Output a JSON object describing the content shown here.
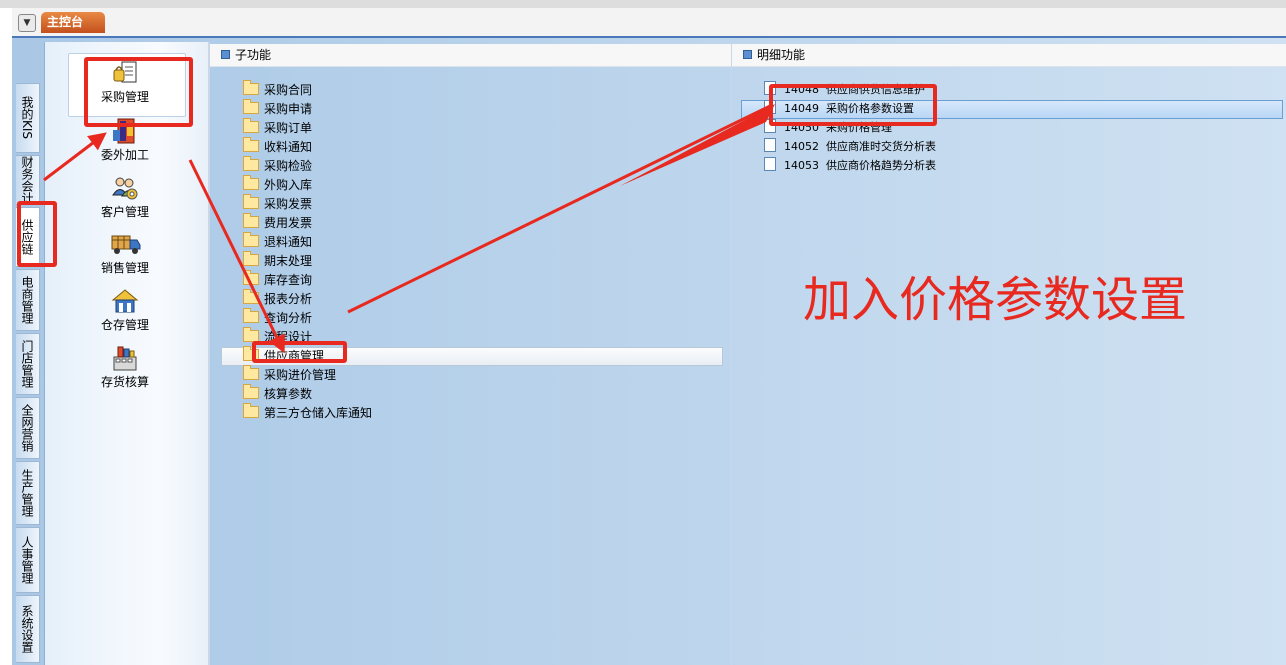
{
  "tabbar": {
    "main_tab": "主控台"
  },
  "vertical_tabs": [
    {
      "label": "我的KIS"
    },
    {
      "label": "财务会计"
    },
    {
      "label": "供应链",
      "active": true
    },
    {
      "label": "电商管理"
    },
    {
      "label": "门店管理"
    },
    {
      "label": "全网营销"
    },
    {
      "label": "生产管理"
    },
    {
      "label": "人事管理"
    },
    {
      "label": "系统设置"
    }
  ],
  "modules": [
    {
      "label": "采购管理",
      "icon": "purchase-icon",
      "selected": true
    },
    {
      "label": "委外加工",
      "icon": "outsourcing-icon"
    },
    {
      "label": "客户管理",
      "icon": "customer-icon"
    },
    {
      "label": "销售管理",
      "icon": "sales-truck-icon"
    },
    {
      "label": "仓存管理",
      "icon": "warehouse-icon"
    },
    {
      "label": "存货核算",
      "icon": "inventory-accounting-icon"
    }
  ],
  "subfunctions": {
    "header": "子功能",
    "items": [
      "采购合同",
      "采购申请",
      "采购订单",
      "收料通知",
      "采购检验",
      "外购入库",
      "采购发票",
      "费用发票",
      "退料通知",
      "期末处理",
      "库存查询",
      "报表分析",
      "查询分析",
      "流程设计",
      "供应商管理",
      "采购进价管理",
      "核算参数",
      "第三方仓储入库通知"
    ],
    "selected": "供应商管理"
  },
  "details": {
    "header": "明细功能",
    "items": [
      {
        "code": "14048",
        "label": "供应商供货信息维护"
      },
      {
        "code": "14049",
        "label": "采购价格参数设置",
        "selected": true
      },
      {
        "code": "14050",
        "label": "采购价格管理"
      },
      {
        "code": "14052",
        "label": "供应商准时交货分析表"
      },
      {
        "code": "14053",
        "label": "供应商价格趋势分析表"
      }
    ]
  },
  "annotation": {
    "text": "加入价格参数设置",
    "color": "#e8291f"
  }
}
